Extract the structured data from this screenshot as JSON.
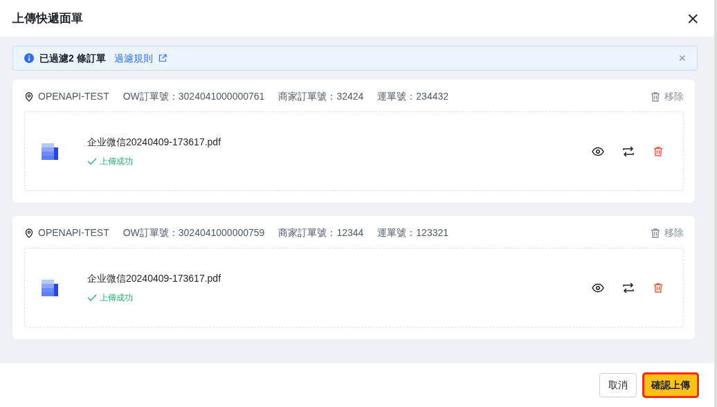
{
  "dialog": {
    "title": "上傳快遞面單",
    "close": "×"
  },
  "alert": {
    "text": "已過濾2 條訂單",
    "link": "過濾規則",
    "close": "×"
  },
  "orders": [
    {
      "shop": "OPENAPI-TEST",
      "ow_no": "OW訂單號：3024041000000761",
      "merchant_no": "商家訂單號：32424",
      "waybill_no": "運單號：234432",
      "remove": "移除",
      "file": {
        "name": "企业微信20240409-173617.pdf",
        "status": "上傳成功"
      }
    },
    {
      "shop": "OPENAPI-TEST",
      "ow_no": "OW訂單號：3024041000000759",
      "merchant_no": "商家訂單號：12344",
      "waybill_no": "運單號：123321",
      "remove": "移除",
      "file": {
        "name": "企业微信20240409-173617.pdf",
        "status": "上傳成功"
      }
    }
  ],
  "footer": {
    "buttons": [
      {
        "label": "取消",
        "kind": "secondary"
      },
      {
        "label": "確認上傳",
        "kind": "primary"
      }
    ]
  }
}
